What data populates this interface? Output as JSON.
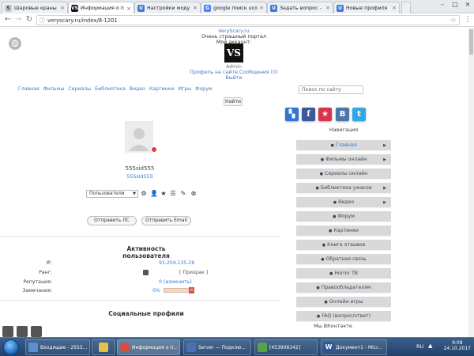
{
  "browser": {
    "tabs": [
      {
        "title": "Шаровые краны",
        "favicon": "S",
        "favicon_color": "#c9c9c9",
        "active": false
      },
      {
        "title": "Информация о п",
        "favicon": "VS",
        "favicon_color": "#111111",
        "active": true
      },
      {
        "title": "Настройки моду",
        "favicon": "U",
        "favicon_color": "#3a7bd5",
        "active": false
      },
      {
        "title": "google поиск ucoz -",
        "favicon": "G",
        "favicon_color": "#4285f4",
        "active": false
      },
      {
        "title": "Задать вопрос -",
        "favicon": "U",
        "favicon_color": "#3a7bd5",
        "active": false
      },
      {
        "title": "Новые профиля",
        "favicon": "U",
        "favicon_color": "#3a7bd5",
        "active": false
      }
    ],
    "url": "veryscary.ru/index/8-1201"
  },
  "header": {
    "site_link": "VeryScary.ru",
    "tagline": "Очень страшный портал",
    "account_label": "Мой аккаунт:",
    "logo_text": "VS",
    "user": "Admin",
    "account_links": "Профиль на сайте Сообщения (0)",
    "logout": "Выйти"
  },
  "top_menu": [
    "Главная",
    "Фильмы",
    "Сериалы",
    "Библиотека",
    "Видео",
    "Картинки",
    "Игры",
    "Форум"
  ],
  "find_button": "Найти",
  "profile": {
    "username": "555sid555",
    "username_link": "555sid555",
    "group_select": "Пользователи",
    "send_pm": "Отправить ЛС",
    "send_email": "Отправить Email"
  },
  "activity": {
    "title": "Активность пользователя",
    "rows": [
      {
        "label": "IP:",
        "value": "91.204.135.26"
      },
      {
        "label": "Ранг:",
        "value": "[ Призрак ]"
      },
      {
        "label": "Репутация:",
        "value": "0 (изменить)"
      },
      {
        "label": "Замечания:",
        "value": "0%"
      }
    ],
    "warnings_percent": 0
  },
  "social_title": "Социальные профили",
  "sidebar": {
    "search_placeholder": "Поиск по сайту",
    "social_icons": [
      {
        "name": "delicious",
        "color": "#3274d1"
      },
      {
        "name": "facebook",
        "color": "#3b5998"
      },
      {
        "name": "favorite",
        "color": "#d8344b"
      },
      {
        "name": "vkontakte",
        "color": "#4a76a8"
      },
      {
        "name": "twitter",
        "color": "#33a7e4"
      }
    ],
    "nav_title": "Навигация",
    "items": [
      {
        "label": "Главная",
        "active": true,
        "arrow": true
      },
      {
        "label": "Фильмы онлайн",
        "active": false,
        "arrow": true
      },
      {
        "label": "Сериалы онлайн",
        "active": false,
        "arrow": false
      },
      {
        "label": "Библиотека ужасов",
        "active": false,
        "arrow": true
      },
      {
        "label": "Видео",
        "active": false,
        "arrow": true
      },
      {
        "label": "Форум",
        "active": false,
        "arrow": false
      },
      {
        "label": "Картинки",
        "active": false,
        "arrow": false
      },
      {
        "label": "Книга отзывов",
        "active": false,
        "arrow": false
      },
      {
        "label": "Обратная связь",
        "active": false,
        "arrow": false
      },
      {
        "label": "Horror TB",
        "active": false,
        "arrow": false
      },
      {
        "label": "Правообладателям",
        "active": false,
        "arrow": false
      },
      {
        "label": "Онлайн игры",
        "active": false,
        "arrow": false
      },
      {
        "label": "FAQ (вопрос/ответ)",
        "active": false,
        "arrow": false
      }
    ],
    "vk_title": "Мы ВКонтакте"
  },
  "taskbar": {
    "items": [
      {
        "title": "Входящие - 2553...",
        "color": "#5b8fd0"
      },
      {
        "title": "",
        "color": "#e5c14a"
      },
      {
        "title": "Информация о п...",
        "color": "#dd4b39",
        "active": true
      },
      {
        "title": "Server — Подклю...",
        "color": "#4a6fb5"
      },
      {
        "title": "[453908342]",
        "color": "#5aa24a"
      },
      {
        "title": "Документ1 - Micr...",
        "color": "#2b579a"
      }
    ],
    "lang": "RU",
    "time": "9:08",
    "date": "24.10.2017"
  }
}
